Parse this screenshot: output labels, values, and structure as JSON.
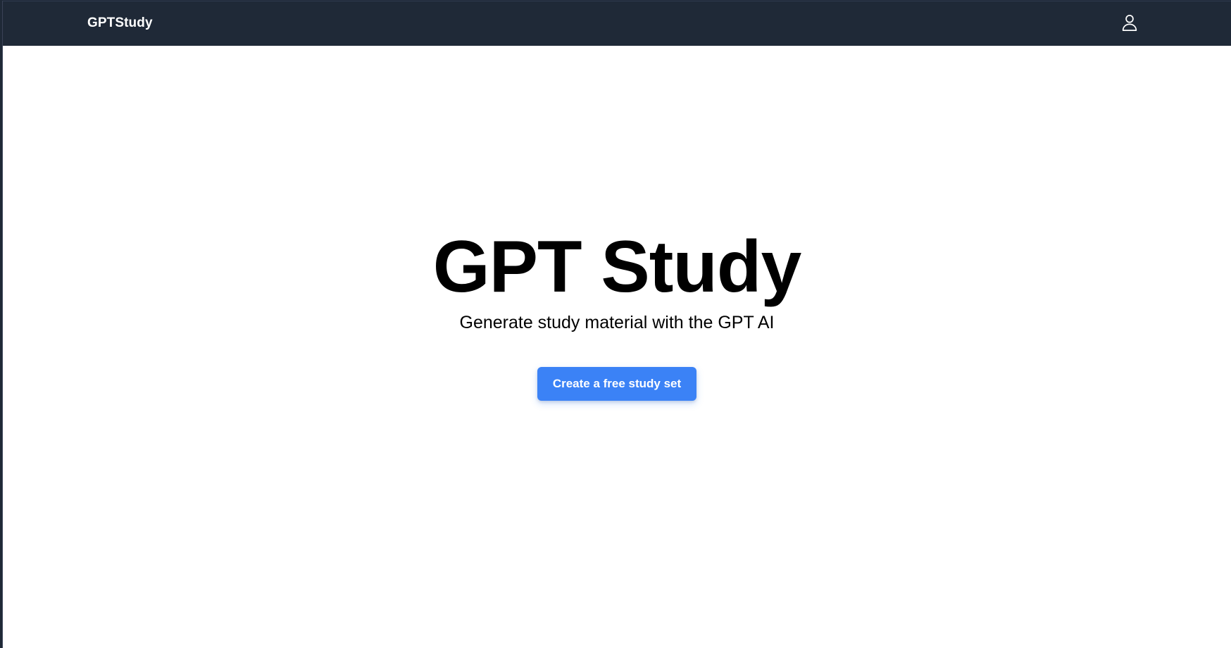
{
  "navbar": {
    "brand": "GPTStudy",
    "user_icon": "user-icon"
  },
  "hero": {
    "title": "GPT Study",
    "subtitle": "Generate study material with the GPT AI",
    "cta_label": "Create a free study set"
  },
  "colors": {
    "navbar_bg": "#1f2937",
    "accent": "#3b82f6",
    "text": "#000000",
    "page_bg": "#ffffff"
  }
}
